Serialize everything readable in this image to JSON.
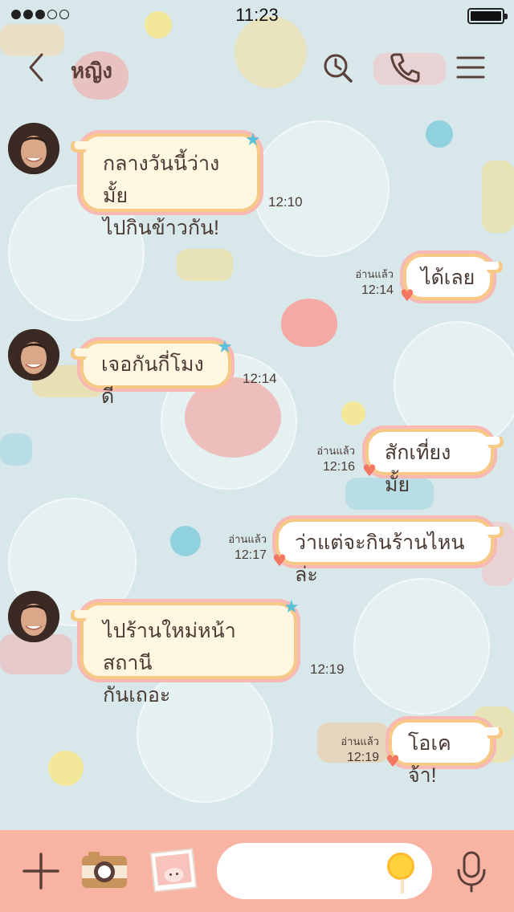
{
  "status": {
    "time": "11:23"
  },
  "header": {
    "title": "หญิง"
  },
  "messages": [
    {
      "dir": "in",
      "lines": [
        "กลางวันนี้ว่างมั้ย",
        "ไปกินข้าวกัน!"
      ],
      "time": "12:10"
    },
    {
      "dir": "out",
      "text": "ได้เลย",
      "read": "อ่านแล้ว",
      "time": "12:14"
    },
    {
      "dir": "in",
      "lines": [
        "เจอกันกี่โมงดี"
      ],
      "time": "12:14"
    },
    {
      "dir": "out",
      "text": "สักเที่ยงมั้ย",
      "read": "อ่านแล้ว",
      "time": "12:16"
    },
    {
      "dir": "out",
      "text": "ว่าแต่จะกินร้านไหนล่ะ",
      "read": "อ่านแล้ว",
      "time": "12:17"
    },
    {
      "dir": "in",
      "lines": [
        "ไปร้านใหม่หน้าสถานี",
        "กันเถอะ"
      ],
      "time": "12:19"
    },
    {
      "dir": "out",
      "text": "โอเคจ้า!",
      "read": "อ่านแล้ว",
      "time": "12:19"
    }
  ],
  "icons": {
    "back": "chevron-left-icon",
    "search": "search-icon",
    "call": "phone-icon",
    "menu": "menu-icon",
    "add": "plus-icon",
    "camera": "camera-icon",
    "gallery": "photo-icon",
    "sticker": "lollipop-icon",
    "mic": "microphone-icon"
  },
  "colors": {
    "background": "#d8e8ea",
    "bubble_border": "#f7c987",
    "bubble_glow": "#f8b9b4",
    "bubble_in_fill": "#fff7e0",
    "bubble_out_fill": "#ffffff",
    "bottom_bar": "#f9b3a3"
  }
}
